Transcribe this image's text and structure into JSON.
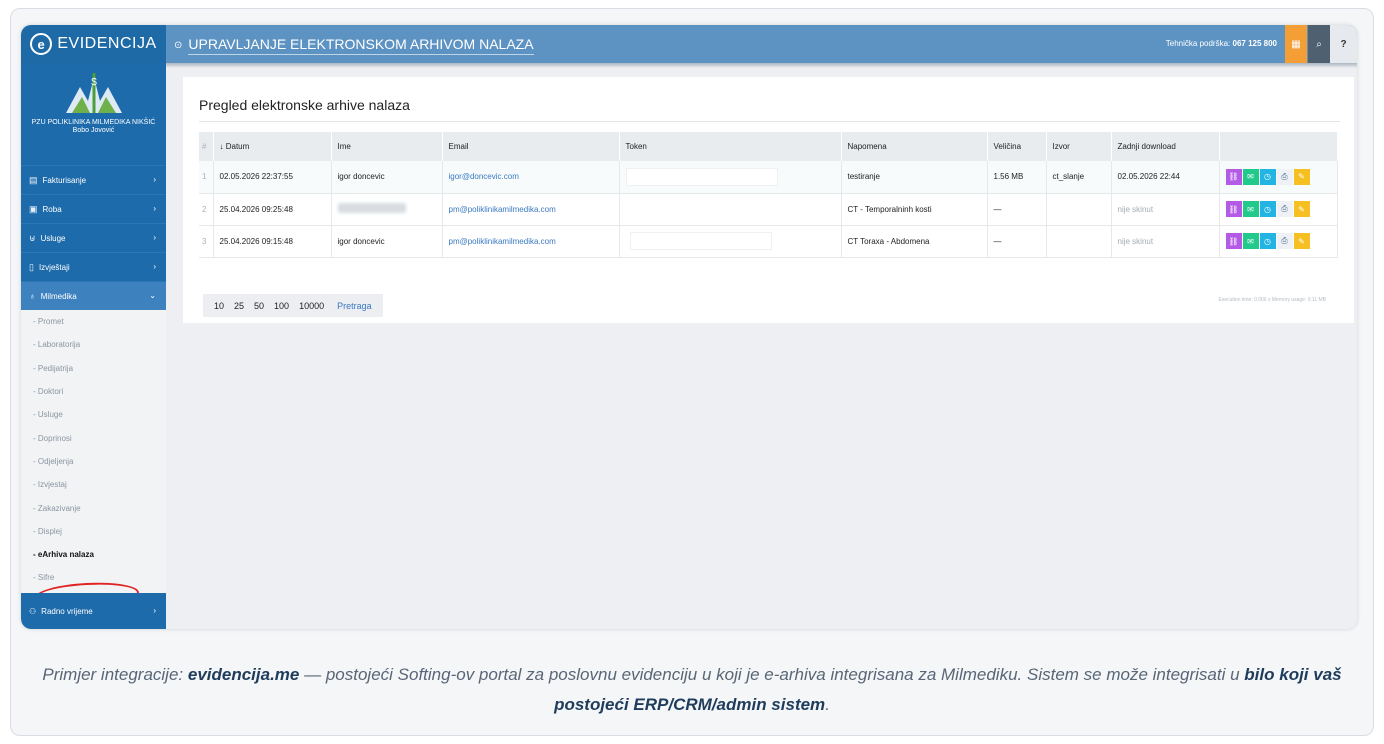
{
  "app": {
    "logo_text": "EVIDENCIJA",
    "page_title": "UPRAVLJANJE ELEKTRONSKOM ARHIVOM NALAZA",
    "support_label": "Tehnička podrška:",
    "support_phone": "067 125 800",
    "help_label": "?"
  },
  "brand": {
    "org": "PZU POLIKLINIKA MILMEDIKA NIKŠIĆ",
    "user": "Bobo Jovović"
  },
  "sidebar": {
    "items": [
      {
        "label": "Fakturisanje"
      },
      {
        "label": "Roba"
      },
      {
        "label": "Usluge"
      },
      {
        "label": "Izvještaji"
      },
      {
        "label": "Milmedika"
      }
    ],
    "sub": [
      "- Promet",
      "- Laboratorija",
      "- Pedijatrija",
      "- Doktori",
      "- Usluge",
      "- Doprinosi",
      "- Odjeljenja",
      "- Izvjestaj",
      "- Zakazivanje",
      "- Displej",
      "- eArhiva nalaza",
      "- Sifre"
    ],
    "bottom": "Radno vrijeme"
  },
  "main": {
    "heading": "Pregled elektronske arhive nalaza",
    "columns": [
      "#",
      "↓ Datum",
      "Ime",
      "Email",
      "Token",
      "Napomena",
      "Veličina",
      "Izvor",
      "Zadnji download"
    ],
    "rows": [
      {
        "n": "1",
        "datum": "02.05.2026 22:37:55",
        "ime": "igor doncevic",
        "email": "igor@doncevic.com",
        "napomena": "testiranje",
        "velicina": "1.56 MB",
        "izvor": "ct_slanje",
        "download": "02.05.2026 22:44"
      },
      {
        "n": "2",
        "datum": "25.04.2026 09:25:48",
        "ime": "",
        "email": "pm@poliklinikamilmedika.com",
        "napomena": "CT - Temporalninh kosti",
        "velicina": "—",
        "izvor": "",
        "download": "nije skinut"
      },
      {
        "n": "3",
        "datum": "25.04.2026 09:15:48",
        "ime": "igor doncevic",
        "email": "pm@poliklinikamilmedika.com",
        "napomena": "CT Toraxa - Abdomena",
        "velicina": "—",
        "izvor": "",
        "download": "nije skinut"
      }
    ],
    "pager": [
      "10",
      "25",
      "50",
      "100",
      "10000"
    ],
    "search_label": "Pretraga",
    "exec_info": "Execution time: 0.006 s  Memory usage: 0.11 MB"
  },
  "caption": {
    "part1": "Primjer integracije: ",
    "bold1": "evidencija.me",
    "part2": " — postojeći Softing-ov portal za poslovnu evidenciju u koji je e-arhiva integrisana za Milmediku. Sistem se može integrisati u ",
    "bold2": "bilo koji vaš postojeći ERP/CRM/admin sistem",
    "part3": "."
  },
  "colors": {
    "primary": "#1d6bab",
    "topbar": "#5d93c3",
    "orange": "#f49e36",
    "annotation": "#e02424"
  }
}
